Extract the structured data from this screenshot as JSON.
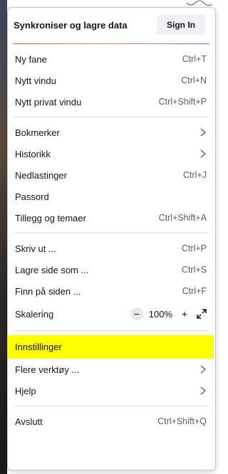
{
  "header": {
    "sync_label": "Synkroniser og lagre data",
    "signin_label": "Sign In"
  },
  "items": [
    {
      "label": "Ny fane",
      "shortcut": "Ctrl+T"
    },
    {
      "label": "Nytt vindu",
      "shortcut": "Ctrl+N"
    },
    {
      "label": "Nytt privat vindu",
      "shortcut": "Ctrl+Shift+P"
    },
    {
      "label": "Bokmerker",
      "shortcut": ""
    },
    {
      "label": "Historikk",
      "shortcut": ""
    },
    {
      "label": "Nedlastinger",
      "shortcut": "Ctrl+J"
    },
    {
      "label": "Passord",
      "shortcut": ""
    },
    {
      "label": "Tillegg og temaer",
      "shortcut": "Ctrl+Shift+A"
    },
    {
      "label": "Skriv ut ...",
      "shortcut": "Ctrl+P"
    },
    {
      "label": "Lagre side som ...",
      "shortcut": "Ctrl+S"
    },
    {
      "label": "Finn på siden ...",
      "shortcut": "Ctrl+F"
    },
    {
      "label": "Skalering",
      "shortcut": ""
    },
    {
      "label": "Innstillinger",
      "shortcut": ""
    },
    {
      "label": "Flere verktøy ...",
      "shortcut": ""
    },
    {
      "label": "Hjelp",
      "shortcut": ""
    },
    {
      "label": "Avslutt",
      "shortcut": "Ctrl+Shift+Q"
    }
  ],
  "zoom": {
    "minus": "−",
    "value": "100%",
    "plus": "+"
  },
  "colors": {
    "highlight": "#ffff00",
    "accent_start": "#ff4a4a",
    "accent_end": "#9059ff"
  }
}
